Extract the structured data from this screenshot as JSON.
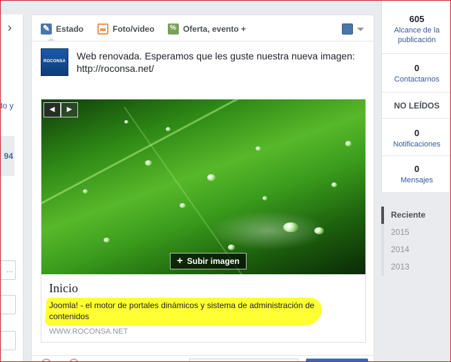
{
  "left": {
    "chevron": "›",
    "link_fragment": "do y",
    "number_fragment": "94",
    "box1": "...",
    "box2": "",
    "box3": ""
  },
  "composer": {
    "tabs": [
      {
        "label": "Estado",
        "icon": "pencil-icon"
      },
      {
        "label": "Foto/video",
        "icon": "photo-icon"
      },
      {
        "label": "Oferta, evento +",
        "icon": "offer-icon"
      }
    ],
    "page_avatar_text": "ROCONSA",
    "post_text": "Web renovada. Esperamos que les guste nuestra nueva imagen: http://roconsa.net/",
    "preview": {
      "title": "Inicio",
      "description": "Joomla! - el motor de portales dinámicos y sistema de administración de contenidos",
      "domain": "WWW.ROCONSA.NET",
      "upload_label": "Subir imagen",
      "prev_symbol": "◀",
      "next_symbol": "▶"
    }
  },
  "stats": {
    "reach": {
      "value": "605",
      "label": "Alcance de la publicación"
    },
    "contact": {
      "value": "0",
      "label": "Contactarnos"
    },
    "unread_title": "NO LEÍDOS",
    "notifications": {
      "value": "0",
      "label": "Notificaciones"
    },
    "messages": {
      "value": "0",
      "label": "Mensajes"
    }
  },
  "timeline": [
    "Reciente",
    "2015",
    "2014",
    "2013"
  ],
  "colors": {
    "facebook_blue": "#4267b2",
    "link": "#365899",
    "highlight": "#ffff33"
  }
}
